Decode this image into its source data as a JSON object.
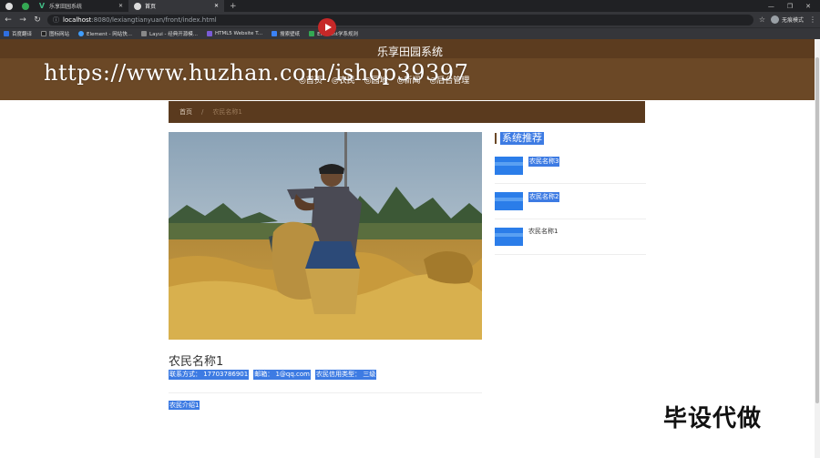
{
  "browser": {
    "tabs": [
      {
        "label": "",
        "icon": "chrome-icon"
      },
      {
        "label": "",
        "icon": "green-app-icon"
      },
      {
        "label": "乐享田园系统",
        "icon": "vue-icon"
      },
      {
        "label": "首页",
        "icon": "globe-icon"
      }
    ],
    "address": {
      "host": "localhost",
      "path": ":8080/lexiangtianyuan/front/index.html"
    },
    "profile": "无痕模式",
    "bookmarks": [
      "百度翻译",
      "图标网站",
      "Element - 网站快...",
      "Layui - 经典开源模...",
      "HTML5 Website T...",
      "搜索壁纸",
      "Element学系规则"
    ]
  },
  "site": {
    "title": "乐享田园系统",
    "nav": [
      "◎首页",
      "◎农民",
      "◎园地",
      "◎新闻",
      "◎后台管理"
    ]
  },
  "watermark": "https://www.huzhan.com/ishop39397",
  "breadcrumb": {
    "home": "首页",
    "sep": "/",
    "current": "农民名称1"
  },
  "farmer": {
    "name": "农民名称1",
    "contact": "联系方式： 17703786901",
    "email": "邮箱： 1@qq.com",
    "credit": "农民信用类型： 三级",
    "intro": "农民介绍1"
  },
  "sidebar": {
    "title": "系统推荐",
    "items": [
      {
        "name": "农民名称3"
      },
      {
        "name": "农民名称2"
      },
      {
        "name": "农民名称1"
      }
    ]
  },
  "overlay_text": "毕设代做",
  "colors": {
    "header": "#6b4826",
    "highlight": "#3d7be3"
  }
}
